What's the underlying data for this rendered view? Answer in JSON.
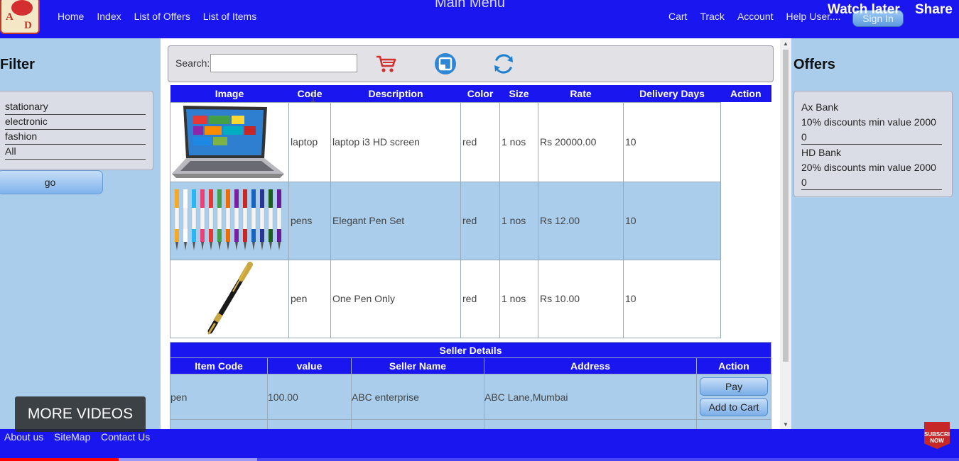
{
  "header": {
    "main_menu": "Main Menu",
    "nav_left": [
      "Home",
      "Index",
      "List of Offers",
      "List of Items"
    ],
    "nav_right": [
      "Cart",
      "Track",
      "Account",
      "Help User...."
    ],
    "sign_in": "Sign In",
    "logo_letters": [
      "A",
      "D"
    ]
  },
  "video": {
    "watch_later": "Watch later",
    "share": "Share",
    "more_videos": "MORE VIDEOS",
    "subscribe": "SUBSCRIBE NOW",
    "progress_played_fraction": 0.124,
    "progress_buffered_fraction": 0.268
  },
  "filter": {
    "title": "Filter",
    "items": [
      "stationary",
      "electronic",
      "fashion",
      "All"
    ],
    "go_label": "go"
  },
  "search": {
    "label": "Search:",
    "value": ""
  },
  "toolbar_icons": [
    "cart-icon",
    "save-icon",
    "refresh-icon"
  ],
  "items_table": {
    "columns": [
      "Image",
      "Code",
      "Description",
      "Color",
      "Size",
      "Rate",
      "Delivery Days",
      "Action"
    ],
    "rows": [
      {
        "image": "laptop",
        "code": "laptop",
        "description": "laptop i3 HD screen",
        "color": "red",
        "size": "1 nos",
        "rate": "Rs 20000.00",
        "delivery": "10"
      },
      {
        "image": "pens",
        "code": "pens",
        "description": "Elegant Pen Set",
        "color": "red",
        "size": "1 nos",
        "rate": "Rs 12.00",
        "delivery": "10"
      },
      {
        "image": "pen",
        "code": "pen",
        "description": "One Pen Only",
        "color": "red",
        "size": "1 nos",
        "rate": "Rs 10.00",
        "delivery": "10"
      }
    ]
  },
  "seller_table": {
    "caption": "Seller Details",
    "columns": [
      "Item Code",
      "value",
      "Seller Name",
      "Address",
      "Action"
    ],
    "rows": [
      {
        "item_code": "pen",
        "value": "100.00",
        "seller": "ABC enterprise",
        "address": "ABC Lane,Mumbai",
        "pay": "Pay",
        "add_to_cart": "Add to Cart"
      }
    ]
  },
  "offers": {
    "title": "Offers",
    "items": [
      {
        "bank": "Ax Bank",
        "line1": "10% discounts min value 2000",
        "line2": "0"
      },
      {
        "bank": "HD Bank",
        "line1": "20% discounts min value 2000",
        "line2": "0"
      }
    ]
  },
  "footer": {
    "links": [
      "About us",
      "SiteMap",
      "Contact Us"
    ]
  },
  "colors": {
    "header_blue": "#1a16f0",
    "page_bg": "#a9cdea",
    "panel_gray": "#dadde6",
    "cart_red": "#d32f2f"
  }
}
